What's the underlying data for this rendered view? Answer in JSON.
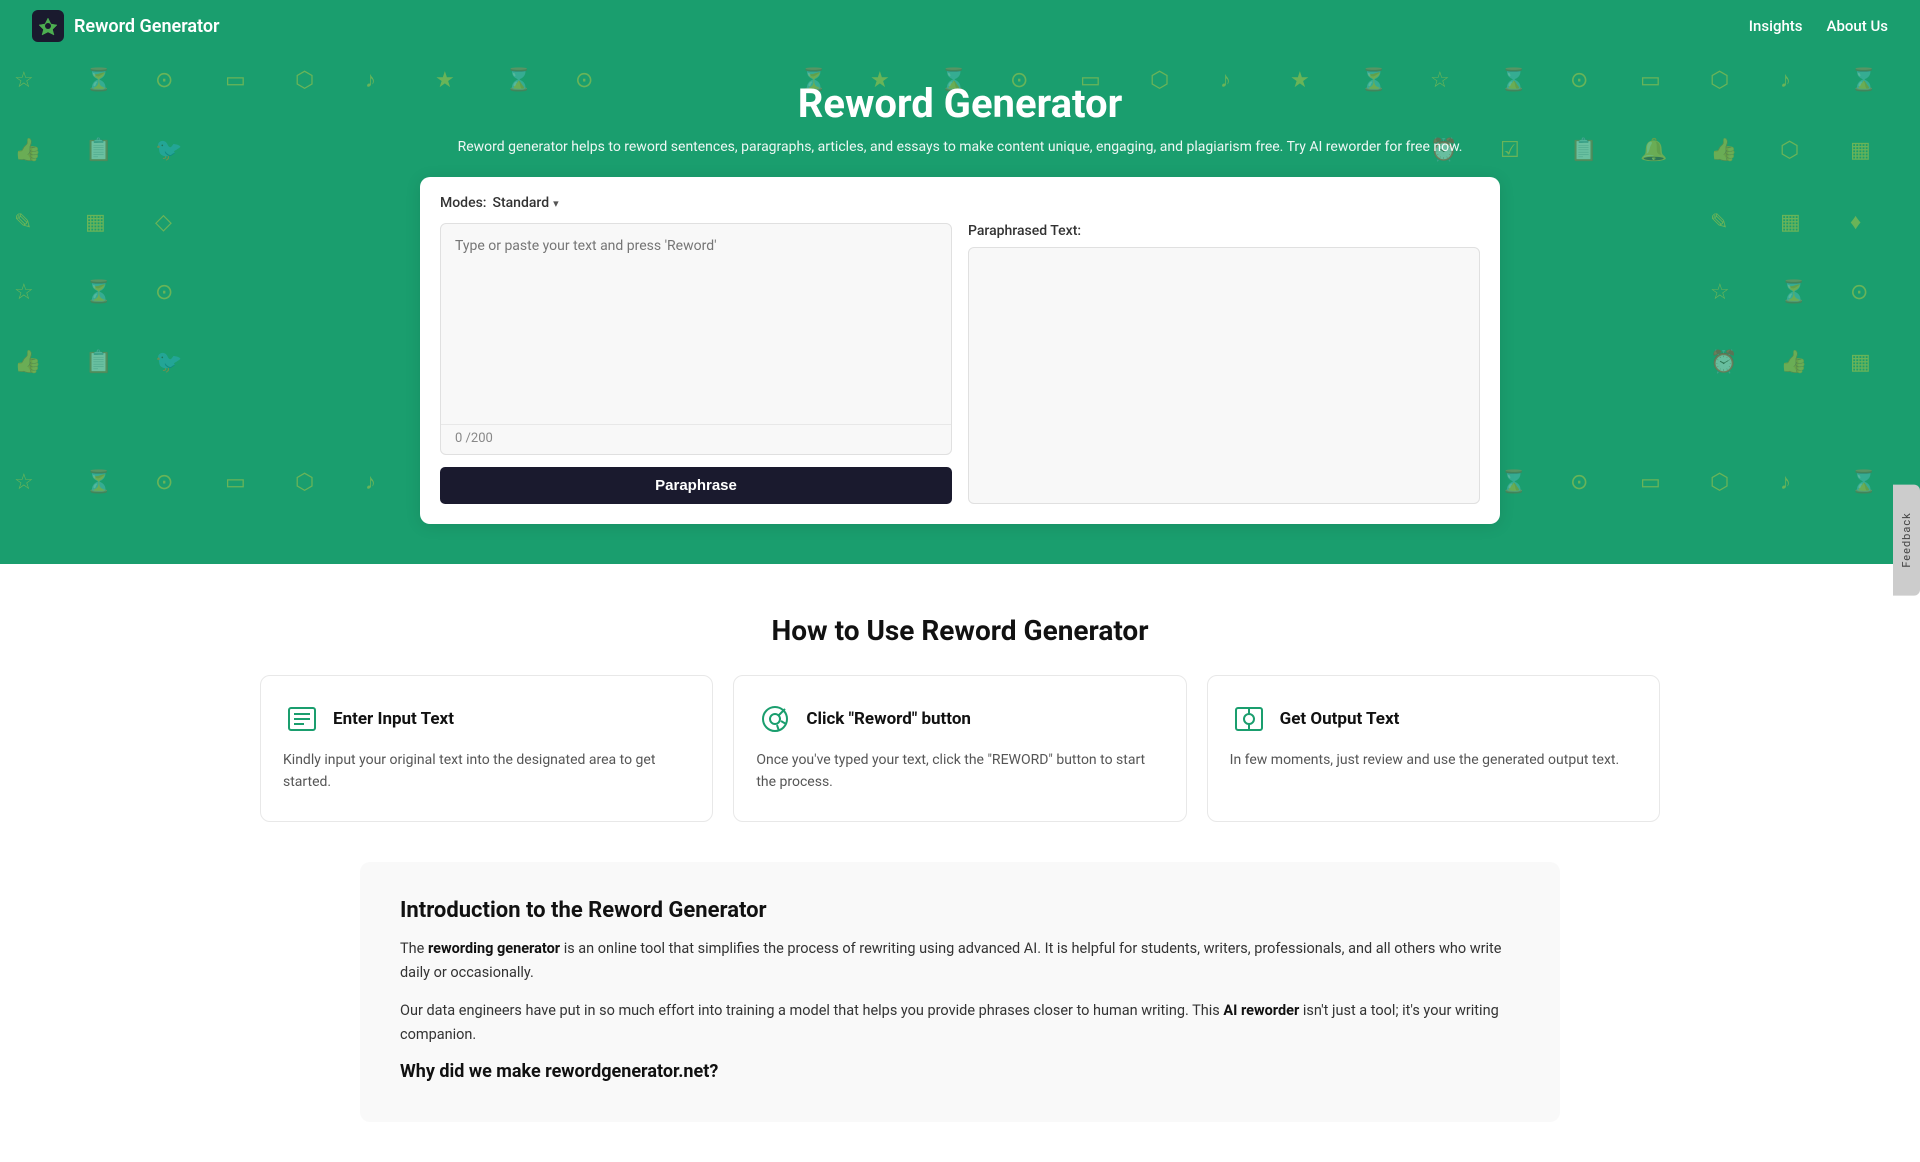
{
  "header": {
    "logo_icon": "✦",
    "logo_text": "Reword Generator",
    "nav": [
      {
        "label": "Insights",
        "href": "#"
      },
      {
        "label": "About Us",
        "href": "#"
      }
    ]
  },
  "hero": {
    "title": "Reword Generator",
    "subtitle": "Reword generator helps to reword sentences, paragraphs, articles, and essays to make content unique, engaging, and plagiarism free. Try AI reworder for free now."
  },
  "tool": {
    "modes_label": "Modes:",
    "mode_selected": "Standard",
    "input_placeholder": "Type or paste your text and press 'Reword'",
    "char_count": "0",
    "char_max": "/200",
    "output_label": "Paraphrased Text:",
    "paraphrase_button": "Paraphrase"
  },
  "how_to": {
    "section_title": "How to Use Reword Generator",
    "steps": [
      {
        "icon": "list",
        "title": "Enter Input Text",
        "desc": "Kindly input your original text into the designated area to get started."
      },
      {
        "icon": "cursor",
        "title": "Click \"Reword\" button",
        "desc": "Once you've typed your text, click the \"REWORD\" button to start the process."
      },
      {
        "icon": "output",
        "title": "Get Output Text",
        "desc": "In few moments, just review and use the generated output text."
      }
    ]
  },
  "intro": {
    "title": "Introduction to the Reword Generator",
    "paragraph1_before": "The ",
    "paragraph1_bold1": "rewording generator",
    "paragraph1_after": " is an online tool that simplifies the process of rewriting using advanced AI. It is helpful for students, writers, professionals, and all others who write daily or occasionally.",
    "paragraph2_before": "Our data engineers have put in so much effort into training a model that helps you provide phrases closer to human writing. This ",
    "paragraph2_bold": "AI reworder",
    "paragraph2_after": " isn't just a tool; it's your writing companion.",
    "subtitle": "Why did we make rewordgenerator.net?"
  },
  "feedback": {
    "label": "Feedback"
  },
  "bg_icons": [
    "☑",
    "⏳",
    "🔍",
    "□",
    "💬",
    "🎵",
    "★",
    "⌛",
    "🔍",
    "□",
    "💬",
    "🎵",
    "★",
    "⏳",
    "👍",
    "📋",
    "🐦",
    "⏰",
    "☑",
    "🎯",
    "⬡",
    "▦",
    "♦",
    "📺",
    "★",
    "⏳",
    "👍",
    "📋",
    "🔔"
  ]
}
